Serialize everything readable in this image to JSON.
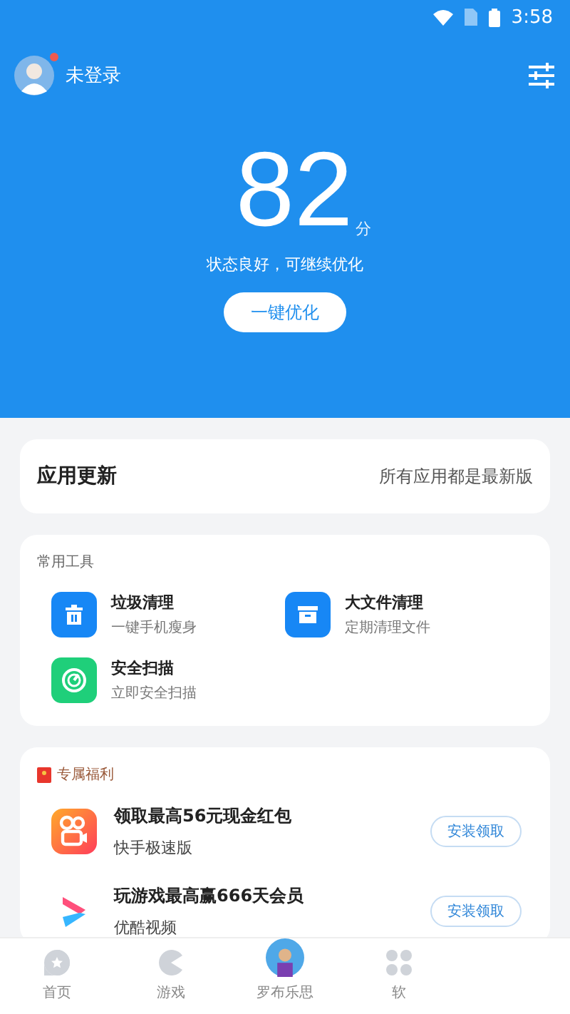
{
  "status_bar": {
    "time": "3:58"
  },
  "header": {
    "user": "未登录",
    "has_notice": true,
    "score": "82",
    "score_unit": "分",
    "status": "状态良好，可继续优化",
    "button": "一键优化"
  },
  "update_card": {
    "title": "应用更新",
    "status": "所有应用都是最新版"
  },
  "tools": {
    "title": "常用工具",
    "items": [
      {
        "kind": "trash",
        "title": "垃圾清理",
        "subtitle": "一键手机瘦身"
      },
      {
        "kind": "box",
        "title": "大文件清理",
        "subtitle": "定期清理文件"
      },
      {
        "kind": "scan",
        "title": "安全扫描",
        "subtitle": "立即安全扫描"
      }
    ]
  },
  "benefits": {
    "title": "专属福利",
    "items": [
      {
        "kind": "camera",
        "title": "领取最高56元现金红包",
        "subtitle": "快手极速版",
        "button": "安装领取"
      },
      {
        "kind": "play",
        "title": "玩游戏最高赢666天会员",
        "subtitle": "优酷视频",
        "button": "安装领取"
      }
    ]
  },
  "tab_bar": [
    {
      "kind": "home",
      "label": "首页",
      "selected": false
    },
    {
      "kind": "game",
      "label": "游戏",
      "selected": false
    },
    {
      "kind": "avatar",
      "label": "罗布乐思",
      "selected": false
    },
    {
      "kind": "apps",
      "label": "软",
      "selected": false
    }
  ]
}
